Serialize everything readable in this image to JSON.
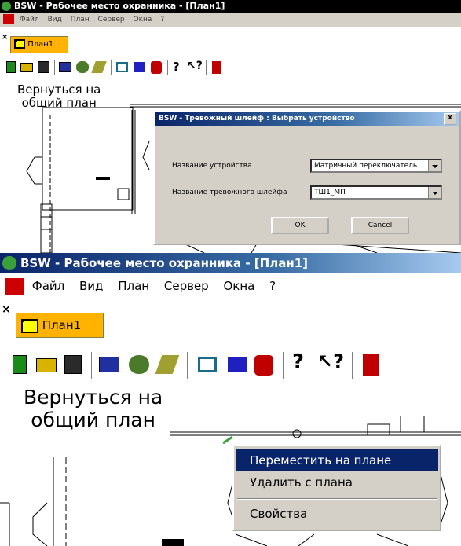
{
  "app": {
    "title": "BSW - Рабочее место охранника - [План1]"
  },
  "menu": [
    "Файл",
    "Вид",
    "План",
    "Сервер",
    "Окна",
    "?"
  ],
  "tab": {
    "label": "План1"
  },
  "plan": {
    "back_link_line1": "Вернуться на",
    "back_link_line2": "общий план"
  },
  "dialog": {
    "title": "BSW - Тревожный шлейф : Выбрать устройство",
    "device_label": "Название устройства",
    "device_value": "Матричный переключатель",
    "loop_label": "Название тревожного шлейфа",
    "loop_value": "ТШ1_МП",
    "ok_label": "OK",
    "cancel_label": "Cancel",
    "close_glyph": "x"
  },
  "context_menu": {
    "items": [
      "Переместить на плане",
      "Удалить с плана",
      "Свойства"
    ],
    "selected_index": 0
  },
  "colors": {
    "title_start": "#0a246a",
    "title_end": "#a6caf0",
    "tab": "#ffb300",
    "face": "#d4d0c8"
  },
  "icons": [
    "app-logo-icon",
    "new-icon",
    "open-icon",
    "save-icon",
    "computer-icon",
    "users-icon",
    "wand-icon",
    "windows-icon",
    "columns-icon",
    "alarm-icon",
    "help-icon",
    "context-help-icon",
    "exit-icon"
  ]
}
